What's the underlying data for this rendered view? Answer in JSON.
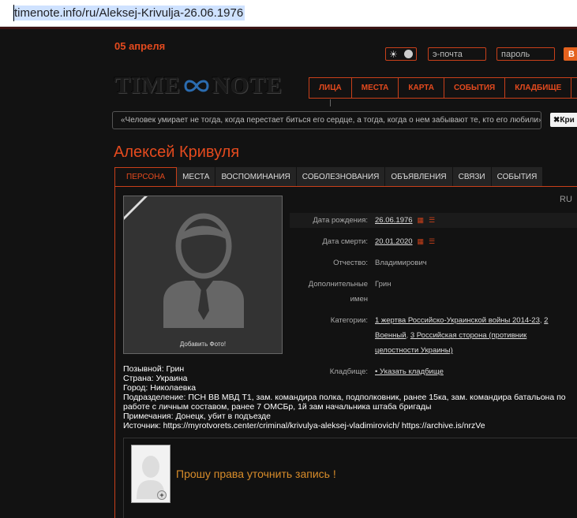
{
  "browser": {
    "url": "timenote.info/ru/Aleksej-Krivulja-26.06.1976"
  },
  "header": {
    "date": "05 апреля",
    "email_placeholder": "э-почта",
    "password_placeholder": "пароль",
    "login_button": "В",
    "logo_left": "TIME",
    "logo_right": "NOTE",
    "theme_sun": "☀",
    "nav": [
      "ЛИЦА",
      "МЕСТА",
      "КАРТА",
      "СОБЫТИЯ",
      "КЛАДБИЩЕ"
    ],
    "quote": "«Человек умирает не тогда, когда перестает биться его сердце, а тогда, когда о нем забывают те, кто его любили»",
    "close_label": "✖Кри"
  },
  "person": {
    "name": "Алексей Кривуля",
    "lang": "RU",
    "add_photo": "Добавить Фото!"
  },
  "tabs": [
    "ПЕРСОНА",
    "МЕСТА",
    "ВОСПОМИНАНИЯ",
    "СОБОЛЕЗНОВАНИЯ",
    "ОБЪЯВЛЕНИЯ",
    "СВЯЗИ",
    "СОБЫТИЯ"
  ],
  "info": {
    "birth_label": "Дата рождения:",
    "birth": "26.06.1976",
    "death_label": "Дата смерти:",
    "death": "20.01.2020",
    "patronymic_label": "Отчество:",
    "patronymic": "Владимирович",
    "extra_names_label": "Дополнительные имен",
    "extra_names": "Грин",
    "categories_label": "Категории:",
    "cat1": "1 жертва Российско-Украинской войны 2014-23",
    "cat2": "2 Военный",
    "cat3": "3 Российская сторона (противник целостности Украины)",
    "cemetery_label": "Кладбище:",
    "cemetery": "• Указать кладбище"
  },
  "bio": [
    "Позывной: Грин",
    "Страна: Украина",
    "Город: Николаевка",
    "Подразделение: ПСН ВВ МВД Т1, зам. командира полка, подполковник, ранее 15ка, зам. командира батальона по работе с личным составом, ранее 7 ОМСБр, 1й зам начальника штаба бригады",
    "Примечания: Донецк, убит в подъезде",
    "Источник: https://myrotvorets.center/criminal/krivulya-aleksej-vladimirovich/ https://archive.is/nrzVe"
  ],
  "request": {
    "message": "Прошу права уточнить запись !",
    "plus": "+"
  },
  "colors": {
    "accent": "#e44a1e",
    "border": "#c9401a",
    "bg": "#121212"
  }
}
